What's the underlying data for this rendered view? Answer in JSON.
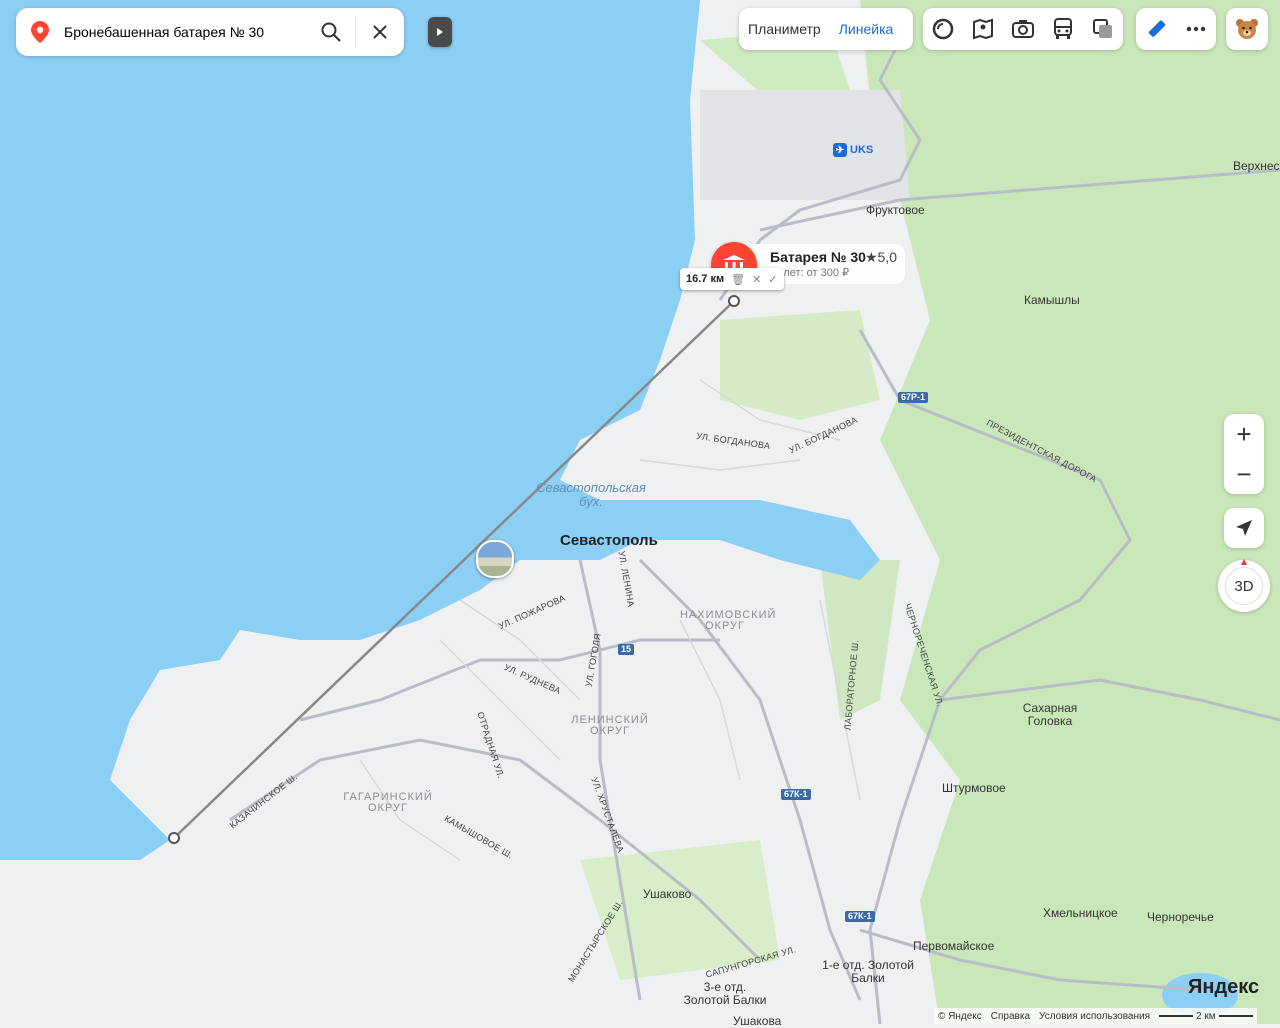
{
  "search": {
    "query": "Бронебашенная батарея № 30"
  },
  "toolbar": {
    "modes": [
      "Планиметр",
      "Линейка"
    ],
    "active_mode": "Линейка",
    "icons": [
      "layers-icon",
      "panorama-icon",
      "photo-icon",
      "transport-icon",
      "tiles-icon"
    ],
    "ruler_icon": "ruler-icon",
    "more_icon": "more-icon",
    "avatar_icon": "bear-avatar-icon"
  },
  "poi": {
    "name": "Батарея № 30",
    "rating": "★5,0",
    "subtitle": "Билет: от 300 ₽"
  },
  "ruler": {
    "distance": "16.7 км"
  },
  "labels": {
    "city": "Севастополь",
    "bay": "Севастопольская бух.",
    "airport": "UKS",
    "districts": [
      "Нахимовский округ",
      "Ленинский округ",
      "Гагаринский округ"
    ],
    "villages": [
      "Верхнес",
      "Фруктовое",
      "Камышлы",
      "Сахарная Головка",
      "Штурмовое",
      "Ушаково",
      "Хмельницкое",
      "Черноречье",
      "Первомайское",
      "1-е отд. Золотой Балки",
      "3-е отд. Золотой Балки",
      "Ушакова"
    ],
    "streets": [
      "ул. Богданова",
      "ул. Богданова",
      "Президентская дорога",
      "ул. Пожарова",
      "ул. Руднева",
      "ул. Гоголя",
      "ул. Ленина",
      "Отрадная ул.",
      "ул. Хрусталева",
      "Камышовое ш.",
      "Казачинское ш.",
      "Лабораторное ш.",
      "Чернореченская ул.",
      "Монастырское ш.",
      "Сапунгорская ул."
    ],
    "roads": [
      "67Р-1",
      "67К-1",
      "67К-1",
      "15"
    ]
  },
  "controls": {
    "zoom_in": "+",
    "zoom_out": "−",
    "view_3d": "3D"
  },
  "footer": {
    "logo": "Яндекс",
    "copyright": "© Яндекс",
    "help": "Справка",
    "terms": "Условия использования",
    "scale": "2 км"
  },
  "colors": {
    "sea": "#8ccff5",
    "land": "#eef0f1",
    "forest": "#c8e6b8",
    "accent": "#1a6dd8",
    "poi": "#ff4433"
  }
}
